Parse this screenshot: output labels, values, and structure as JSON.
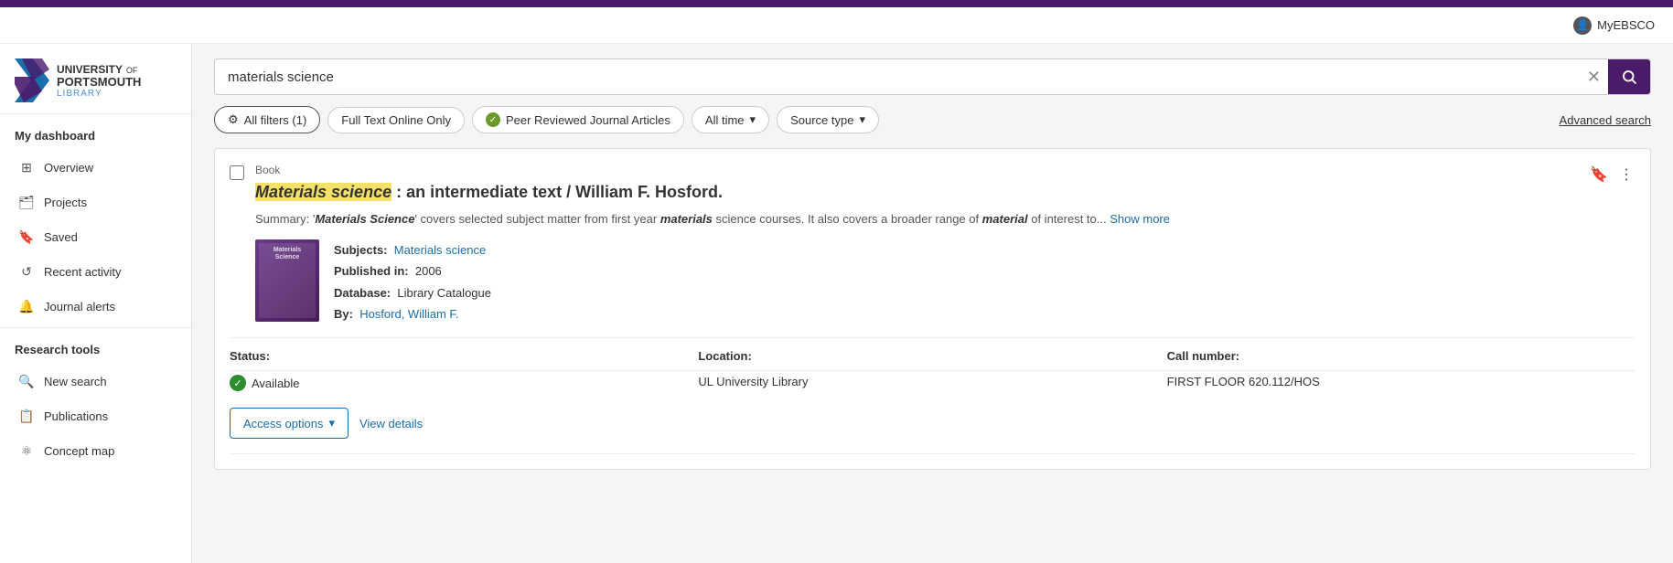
{
  "topbar": {
    "color": "#4a1a6b"
  },
  "header": {
    "myebsco_label": "MyEBSCO"
  },
  "logo": {
    "university": "UNIVERSITY",
    "of": "OF",
    "portsmouth": "PORTSMOUTH",
    "library": "LIBRARY"
  },
  "sidebar": {
    "dashboard_label": "My dashboard",
    "nav_items": [
      {
        "label": "Overview",
        "icon": "⊞"
      },
      {
        "label": "Projects",
        "icon": "🗂"
      },
      {
        "label": "Saved",
        "icon": "🔖"
      },
      {
        "label": "Recent activity",
        "icon": "↺"
      },
      {
        "label": "Journal alerts",
        "icon": "🔔"
      }
    ],
    "research_tools_label": "Research tools",
    "research_items": [
      {
        "label": "New search",
        "icon": "🔍"
      },
      {
        "label": "Publications",
        "icon": "📋"
      },
      {
        "label": "Concept map",
        "icon": "⚛"
      }
    ]
  },
  "search": {
    "query": "materials science",
    "placeholder": "materials science",
    "advanced_search_label": "Advanced search"
  },
  "filters": {
    "all_filters_label": "All filters (1)",
    "full_text_label": "Full Text Online Only",
    "peer_reviewed_label": "Peer Reviewed Journal Articles",
    "all_time_label": "All time",
    "source_type_label": "Source type"
  },
  "result": {
    "type": "Book",
    "title_highlight": "Materials science",
    "title_rest": " : an intermediate text / William F. Hosford.",
    "summary_prefix": "Summary: '",
    "summary_bold1": "Materials Science",
    "summary_middle": "' covers selected subject matter from first year ",
    "summary_bold2": "materials",
    "summary_end": " science courses. It also covers a broader range of ",
    "summary_bold3": "material",
    "summary_tail": " of interest to...",
    "show_more": "Show more",
    "subjects_label": "Subjects:",
    "subjects_value": "Materials science",
    "published_label": "Published in:",
    "published_value": "2006",
    "database_label": "Database:",
    "database_value": "Library Catalogue",
    "by_label": "By:",
    "by_value": "Hosford, William F.",
    "status_header": "Status:",
    "location_header": "Location:",
    "call_number_header": "Call number:",
    "status_value": "Available",
    "location_value": "UL University Library",
    "call_number_value": "FIRST FLOOR 620.112/HOS",
    "access_options_label": "Access options",
    "view_details_label": "View details"
  }
}
